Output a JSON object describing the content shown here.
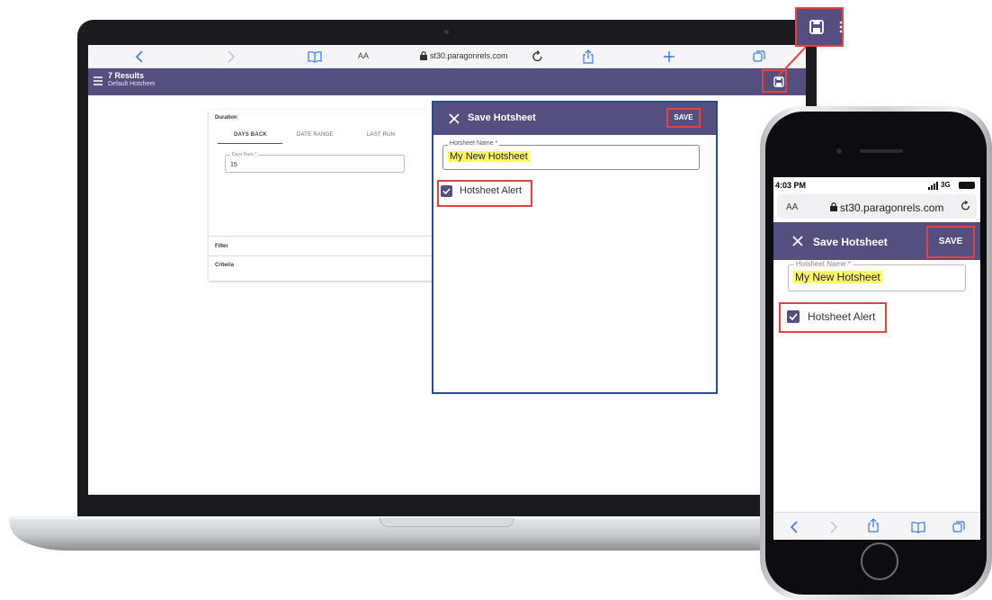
{
  "laptop": {
    "browser": {
      "text_size_label": "AA",
      "url": "st30.paragonrels.com"
    },
    "app_bar": {
      "title": "7 Results",
      "subtitle": "Default Hotsheet"
    },
    "criteria_card": {
      "duration_label": "Duration",
      "tabs": [
        "DAYS BACK",
        "DATE RANGE",
        "LAST RUN"
      ],
      "active_tab": "DAYS BACK",
      "days_back_label": "Days Back *",
      "days_back_value": "15",
      "filter_label": "Filter",
      "criteria_label": "Criteria"
    },
    "dialog": {
      "title": "Save Hotsheet",
      "save_label": "SAVE",
      "name_label": "Hotsheet Name *",
      "name_value": "My New Hotsheet",
      "alert_label": "Hotsheet Alert",
      "alert_checked": true
    }
  },
  "phone": {
    "status": {
      "time": "4:03 PM",
      "network": "3G"
    },
    "browser": {
      "text_size_label": "AA",
      "url": "st30.paragonrels.com"
    },
    "dialog": {
      "title": "Save Hotsheet",
      "save_label": "SAVE",
      "name_label": "Hotsheet Name *",
      "name_value": "My New Hotsheet",
      "alert_label": "Hotsheet Alert",
      "alert_checked": true
    }
  },
  "colors": {
    "brand_purple": "#544f7e",
    "highlight_red": "#e6403f",
    "highlight_yellow": "#fff96a",
    "dialog_border_blue": "#2b4b8c"
  }
}
